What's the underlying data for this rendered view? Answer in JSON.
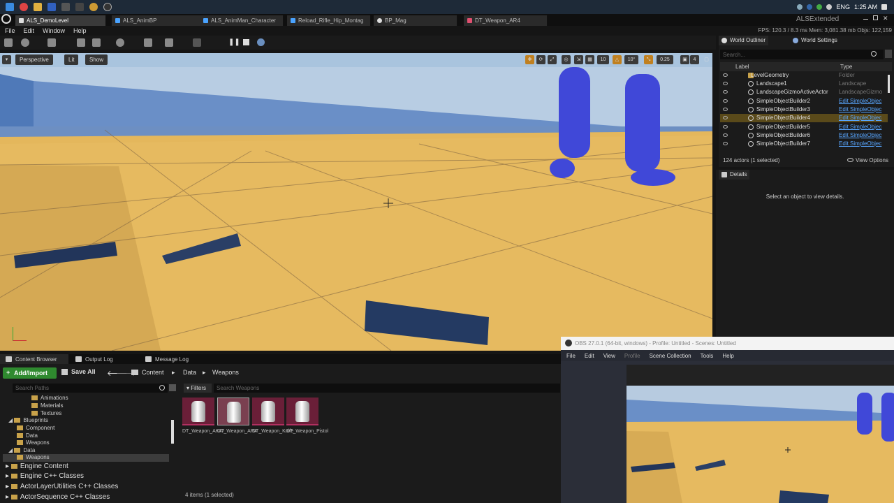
{
  "taskbar": {
    "tray_lang": "ENG",
    "time": "1:25 AM"
  },
  "doc_tabs": [
    {
      "label": "ALS_DemoLevel",
      "color": "#dddddd"
    },
    {
      "label": "ALS_AnimBP",
      "color": "#4aa3ff"
    },
    {
      "label": "ALS_AnimMan_Character",
      "color": "#4aa3ff"
    },
    {
      "label": "Reload_Rifle_Hip_Montag",
      "color": "#4aa3ff"
    },
    {
      "label": "BP_Mag",
      "color": "#dddddd"
    },
    {
      "label": "DT_Weapon_AR4",
      "color": "#e05070"
    }
  ],
  "project_name": "ALSExtended",
  "menu": [
    "File",
    "Edit",
    "Window",
    "Help"
  ],
  "stats": "FPS: 120.3 / 8.3 ms  Mem: 3,081.38 mb  Objs: 122,159",
  "viewport": {
    "perspective_label": "Perspective",
    "lit_label": "Lit",
    "show_label": "Show",
    "grid_snap": "10",
    "rot_snap": "10°",
    "scale_snap": "0.25",
    "camera_speed": "4"
  },
  "outliner": {
    "tab_label": "World Outliner",
    "settings_tab_label": "World Settings",
    "search_placeholder": "Search...",
    "col_label": "Label",
    "col_type": "Type",
    "rows": [
      {
        "label": "LevelGeometry",
        "type": "Folder",
        "link": false
      },
      {
        "label": "Landscape1",
        "type": "Landscape",
        "link": false
      },
      {
        "label": "LandscapeGizmoActiveActor",
        "type": "LandscapeGizmo",
        "link": false
      },
      {
        "label": "SimpleObjectBuilder2",
        "type": "Edit SimpleObjec",
        "link": true
      },
      {
        "label": "SimpleObjectBuilder3",
        "type": "Edit SimpleObjec",
        "link": true
      },
      {
        "label": "SimpleObjectBuilder4",
        "type": "Edit SimpleObjec",
        "link": true
      },
      {
        "label": "SimpleObjectBuilder5",
        "type": "Edit SimpleObjec",
        "link": true
      },
      {
        "label": "SimpleObjectBuilder6",
        "type": "Edit SimpleObjec",
        "link": true
      },
      {
        "label": "SimpleObjectBuilder7",
        "type": "Edit SimpleObjec",
        "link": true
      }
    ],
    "actor_count": "124 actors (1 selected)",
    "view_options": "View Options"
  },
  "details": {
    "tab_label": "Details",
    "empty_text": "Select an object to view details."
  },
  "content_browser": {
    "tabs": [
      "Content Browser",
      "Output Log",
      "Message Log"
    ],
    "add_import": "Add/Import",
    "save_all": "Save All",
    "breadcrumb": [
      "Content",
      "Data",
      "Weapons"
    ],
    "search_paths_placeholder": "Search Paths",
    "filters_label": "Filters",
    "search_assets_placeholder": "Search Weapons",
    "tree": [
      {
        "label": "Animations",
        "big": false
      },
      {
        "label": "Materials",
        "big": false
      },
      {
        "label": "Textures",
        "big": false
      },
      {
        "label": "Blueprints",
        "big": false
      },
      {
        "label": "Component",
        "big": false
      },
      {
        "label": "Data",
        "big": false
      },
      {
        "label": "Weapons",
        "big": false
      },
      {
        "label": "Data",
        "big": false
      },
      {
        "label": "Weapons",
        "big": false
      },
      {
        "label": "Engine Content",
        "big": true
      },
      {
        "label": "Engine C++ Classes",
        "big": true
      },
      {
        "label": "ActorLayerUtilities C++ Classes",
        "big": true
      },
      {
        "label": "ActorSequence C++ Classes",
        "big": true
      }
    ],
    "assets": [
      {
        "name": "DT_Weapon_AK47",
        "selected": false
      },
      {
        "name": "DT_Weapon_AR4",
        "selected": true
      },
      {
        "name": "DT_Weapon_Knife",
        "selected": false
      },
      {
        "name": "DT_Weapon_Pistol",
        "selected": false
      }
    ],
    "status": "4 items (1 selected)"
  },
  "obs": {
    "title": "OBS 27.0.1 (64-bit, windows) - Profile: Untitled - Scenes: Untitled",
    "menu": [
      "File",
      "Edit",
      "View",
      "Profile",
      "Scene Collection",
      "Tools",
      "Help"
    ]
  }
}
